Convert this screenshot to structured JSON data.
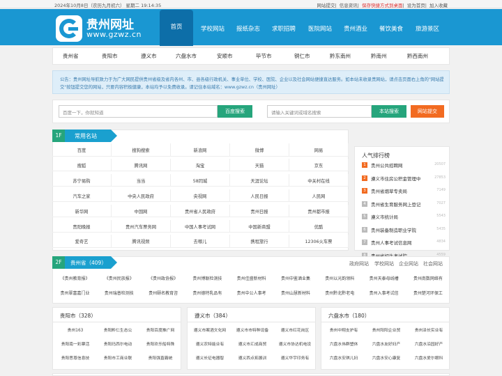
{
  "topbar": {
    "date": "2024年10月8日（农历九月初六） 星期二 19:14:35",
    "links": [
      "网站提交",
      "信息资讯",
      "保存快捷方式到桌面",
      "设为首页",
      "加入收藏"
    ]
  },
  "header": {
    "site_name": "贵州网址",
    "site_url": "www.gzwz.cn",
    "nav": [
      "首页",
      "学校网站",
      "报纸杂志",
      "求职招聘",
      "医院网站",
      "贵州酒业",
      "餐饮美食",
      "旅游景区"
    ]
  },
  "cities": [
    "贵州省",
    "贵阳市",
    "遵义市",
    "六盘水市",
    "安顺市",
    "毕节市",
    "铜仁市",
    "黔东南州",
    "黔南州",
    "黔西南州"
  ],
  "notice": "公告：贵州网址导航致力于为广大网民提供贵州省级及省内各州、市、县各级行政机关、事业单位、学校、医院、企业以及社会网站便捷直达服务。如本站未收录贵网站，请点击页面右上角的\"网站提交\"按钮提交您的网站，只要内容积极健康，本站均予以免费收录。请记住本站域名：www.gzwz.cn（贵州网址）",
  "search": {
    "placeholder1": "百度一下，你就知道",
    "btn1": "百度搜索",
    "placeholder2": "请输入关键词或域名搜索",
    "btn2": "本站搜索",
    "btn3": "网站提交"
  },
  "section1": {
    "num": "1F",
    "title": "常用名站",
    "rows": [
      [
        "百度",
        "搜狗搜索",
        "新浪网",
        "微博",
        "网易"
      ],
      [
        "搜狐",
        "腾讯网",
        "淘宝",
        "天猫",
        "京东"
      ],
      [
        "苏宁易购",
        "当当",
        "58同城",
        "天涯论坛",
        "中关村在线"
      ],
      [
        "汽车之家",
        "中央人民政府",
        "央视网",
        "人民日报",
        "人民网"
      ],
      [
        "新华网",
        "中国网",
        "贵州省人民政府",
        "贵州日报",
        "贵州都市报"
      ],
      [
        "贵阳晚报",
        "贵州汽车票务网",
        "中国人事考试网",
        "中国新商盟",
        "优酷"
      ],
      [
        "爱奇艺",
        "腾讯视频",
        "去哪儿",
        "携程旅行",
        "12306火车票"
      ]
    ]
  },
  "hot": {
    "title": "人气排行榜",
    "items": [
      {
        "n": "1",
        "name": "贵州公共招聘网",
        "count": "20507"
      },
      {
        "n": "2",
        "name": "遵义市住房公积金管理中",
        "count": "27853"
      },
      {
        "n": "3",
        "name": "贵州省烟草专卖局",
        "count": "7149"
      },
      {
        "n": "4",
        "name": "贵州省生育服务网上登记",
        "count": "7027"
      },
      {
        "n": "5",
        "name": "遵义市统计局",
        "count": "5543"
      },
      {
        "n": "6",
        "name": "贵州装备制造职业学院",
        "count": "5435"
      },
      {
        "n": "7",
        "name": "贵州人事考试信息网",
        "count": "4834"
      },
      {
        "n": "8",
        "name": "贵州省招生考试院",
        "count": "4559"
      }
    ]
  },
  "section2": {
    "num": "2F",
    "title": "贵州省（409）",
    "tabs": [
      "政府网站",
      "学校网站",
      "企业网站",
      "社会网站"
    ],
    "rows": [
      [
        "《贵州教育报》",
        "《贵州民族报》",
        "《贵州政协报》",
        "贵州博联检测技",
        "贵州佳盛新材料",
        "贵州中鉴酒业集",
        "贵州以光韵领科",
        "贵州天泰母线槽",
        "贵州南数网络有"
      ],
      [
        "贵州翠富嘉门业",
        "贵州瑞普检测技",
        "贵州颐名教育咨",
        "贵州德特乳品有",
        "贵州中公人事考",
        "贵州山慧新材料",
        "贵州黔北黔老电",
        "贵州入事考试信",
        "贵州楚河环保工"
      ]
    ]
  },
  "city_panels": [
    {
      "title": "贵阳市（328）",
      "items": [
        "贵州163",
        "贵阳黔仁生态公",
        "贵阳百度推广网",
        "贵阳南一彩票活",
        "贵阳玛西尔电动",
        "贵阳欢乐船特殊",
        "贵阳思尊信息技",
        "贵阳市工商业联",
        "贵阳强直霸统"
      ]
    },
    {
      "title": "遵义市（384）",
      "items": [
        "遵义市案酒文化网",
        "遵义市市特种设备",
        "遵义市红花岗区",
        "遵义农特能业有",
        "遵义市汇成商贸",
        "遵义市协达机电设",
        "遵义长征电器智",
        "遵义西点拓展训",
        "遵义华宇印务有"
      ]
    },
    {
      "title": "六盘水市（180）",
      "items": [
        "贵州中翔支护有",
        "贵州阳阳企业贸",
        "贵州泽长实业有",
        "六盘水伟群塑休",
        "六盘水友好妇产",
        "六盘水沿园好产",
        "六盘水安琪儿妇",
        "六盘水安心康复",
        "六盘水爱尔眼科"
      ]
    }
  ]
}
